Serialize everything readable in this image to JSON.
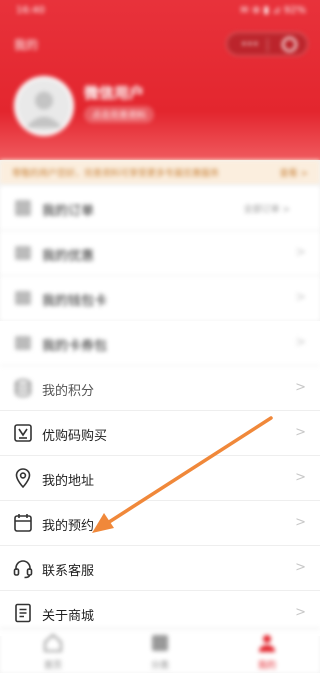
{
  "status_bar": {
    "time": "16:40",
    "indicators": "✉ ⊕ ▮ ⊿ 92%"
  },
  "header": {
    "title": "我的",
    "user_name": "微信用户",
    "user_tag": "点击完善资料",
    "capsule_icons": [
      "more-icon",
      "close-circle-icon"
    ],
    "background_color": "#e3262e"
  },
  "notice": {
    "text": "尊敬的用户您好，完善资料可享受更多专属优惠服务",
    "more": "查看 >"
  },
  "menu_group_1": [
    {
      "icon": "order-icon",
      "label": "我的订单",
      "extra": "全部订单 >"
    },
    {
      "icon": "coupon-icon",
      "label": "我的优惠"
    },
    {
      "icon": "wallet-icon",
      "label": "我的钱包卡"
    }
  ],
  "menu_group_2": [
    {
      "icon": "card-icon",
      "label": "我的卡券包"
    },
    {
      "icon": "coins-icon",
      "label": "我的积分"
    },
    {
      "icon": "voucher-code-icon",
      "label": "优购码购买"
    },
    {
      "icon": "location-pin-icon",
      "label": "我的地址"
    },
    {
      "icon": "calendar-icon",
      "label": "我的预约"
    },
    {
      "icon": "headset-icon",
      "label": "联系客服"
    },
    {
      "icon": "document-icon",
      "label": "关于商城"
    }
  ],
  "chevron": ">",
  "tabbar": [
    {
      "icon": "home-icon",
      "label": "首页",
      "active": false
    },
    {
      "icon": "grid-icon",
      "label": "分类",
      "active": false
    },
    {
      "icon": "person-icon",
      "label": "我的",
      "active": true
    }
  ],
  "colors": {
    "accent": "#e3262e",
    "arrow": "#f0883a",
    "notice_bg": "#fbeede"
  }
}
